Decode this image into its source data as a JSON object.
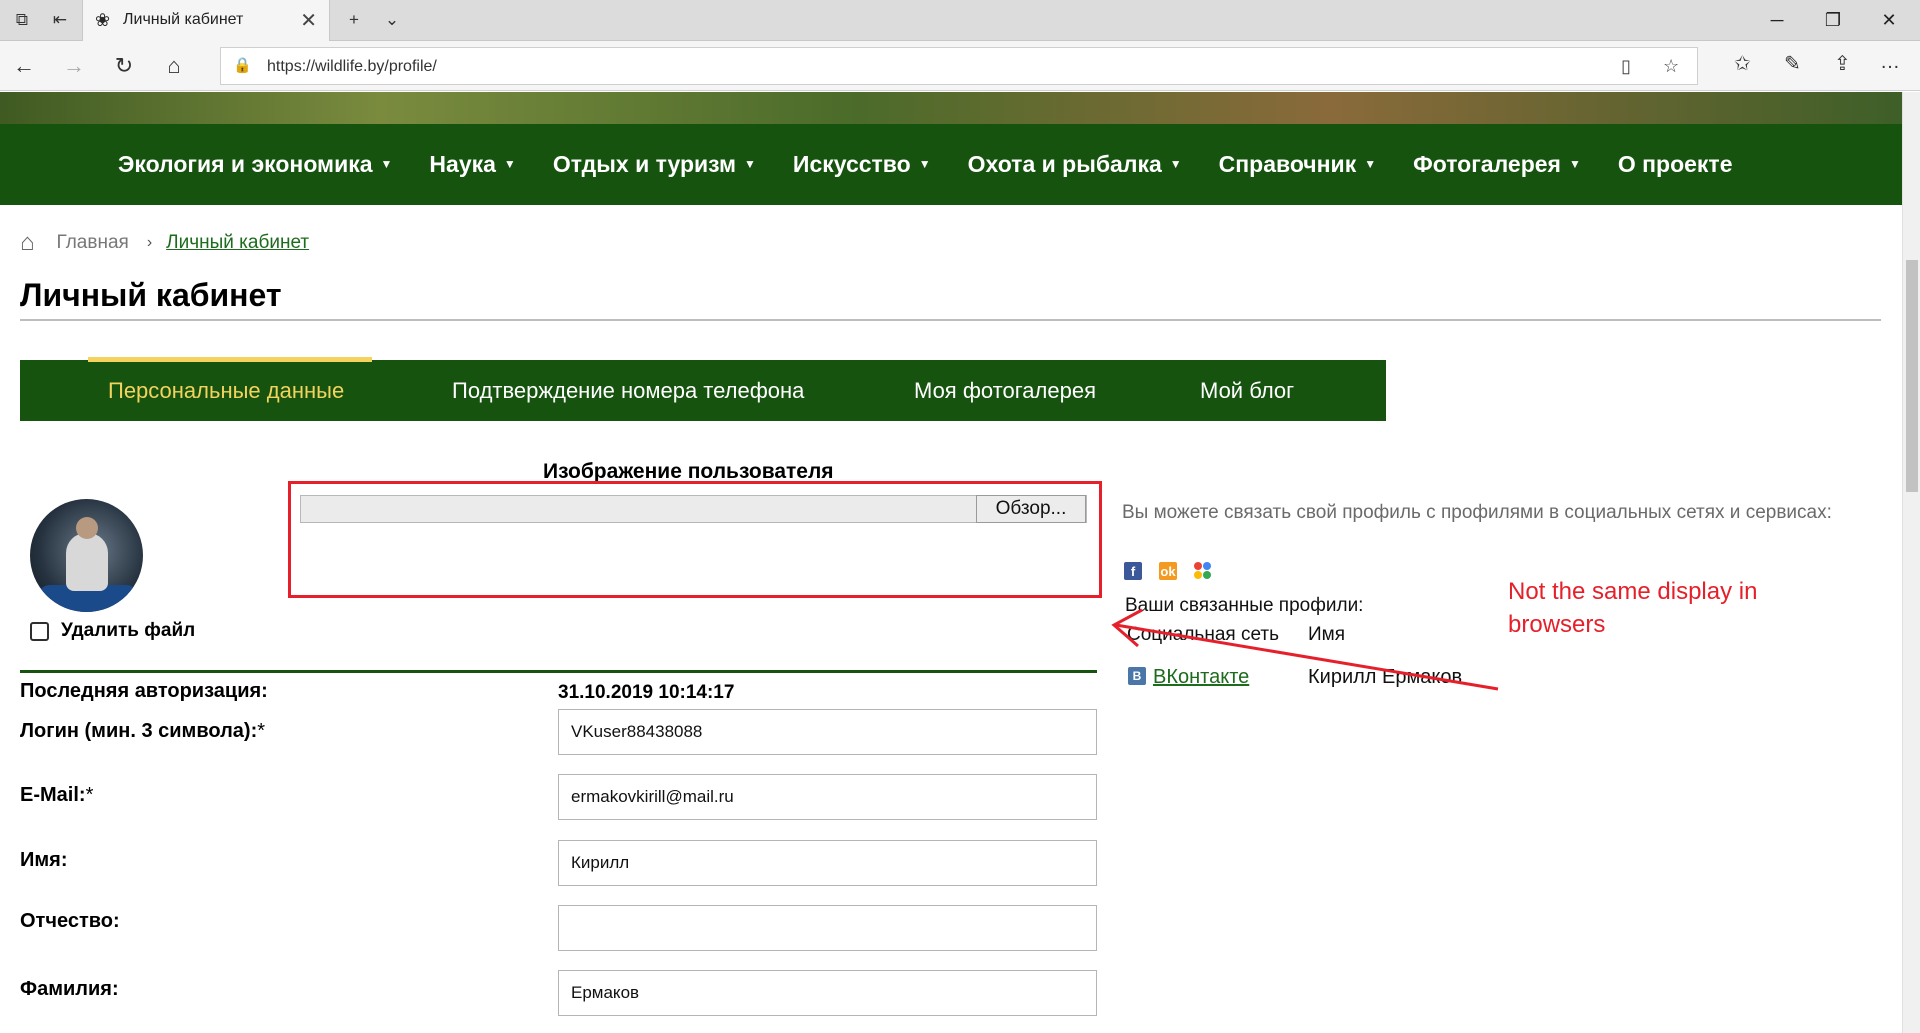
{
  "browser": {
    "tab_title": "Личный кабинет",
    "url": "https://wildlife.by/profile/"
  },
  "nav": {
    "items": [
      {
        "label": "Экология и экономика",
        "has_dropdown": true
      },
      {
        "label": "Наука",
        "has_dropdown": true
      },
      {
        "label": "Отдых и туризм",
        "has_dropdown": true
      },
      {
        "label": "Искусство",
        "has_dropdown": true
      },
      {
        "label": "Охота и рыбалка",
        "has_dropdown": true
      },
      {
        "label": "Справочник",
        "has_dropdown": true
      },
      {
        "label": "Фотогалерея",
        "has_dropdown": true
      },
      {
        "label": "О проекте",
        "has_dropdown": false
      }
    ]
  },
  "breadcrumb": {
    "home": "Главная",
    "current": "Личный кабинет"
  },
  "page_title": "Личный кабинет",
  "profile_tabs": [
    {
      "label": "Персональные данные",
      "active": true
    },
    {
      "label": "Подтверждение номера телефона",
      "active": false
    },
    {
      "label": "Моя фотогалерея",
      "active": false
    },
    {
      "label": "Мой блог",
      "active": false
    }
  ],
  "avatar_section": {
    "heading": "Изображение пользователя",
    "browse_button": "Обзор...",
    "delete_label": "Удалить файл"
  },
  "fields": {
    "last_auth_label": "Последняя авторизация:",
    "last_auth_value": "31.10.2019 10:14:17",
    "login_label": "Логин (мин. 3 символа):",
    "login_value": "VKuser88438088",
    "email_label": "E-Mail:",
    "email_value": "ermakovkirill@mail.ru",
    "name_label": "Имя:",
    "name_value": "Кирилл",
    "patronymic_label": "Отчество:",
    "patronymic_value": "",
    "surname_label": "Фамилия:",
    "surname_value": "Ермаков",
    "required_mark": "*"
  },
  "social": {
    "intro": "Вы можете связать свой профиль с профилями в социальных сетях и сервисах:",
    "linked_title": "Ваши связанные профили:",
    "col_network": "Социальная сеть",
    "col_name": "Имя",
    "linked": [
      {
        "network": "ВКонтакте",
        "name": "Кирилл Ермаков"
      }
    ]
  },
  "annotation": {
    "text": "Not the same display in browsers",
    "color": "#e6202a"
  },
  "colors": {
    "brand_green": "#15530f",
    "active_tab": "#f3d35e",
    "link_green": "#1d6b1d"
  }
}
